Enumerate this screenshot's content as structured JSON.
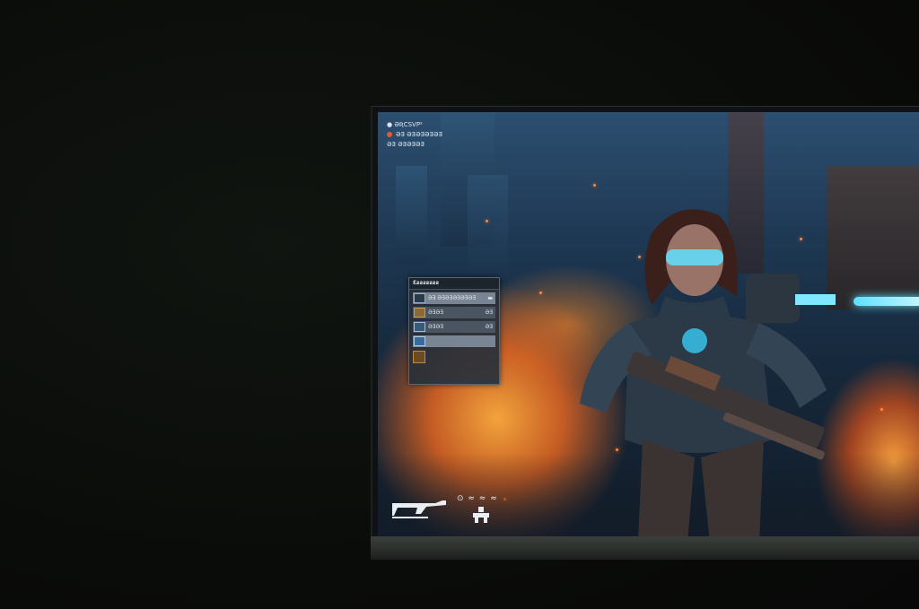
{
  "hud": {
    "top_lines": [
      {
        "text": "● ƏƦCSVP²",
        "color": "#d8e6f2"
      },
      {
        "text": "ƏƎ ƏƎƏƎƏƎƏƎ",
        "color": "#e05a3a"
      },
      {
        "text": "ƏƎ ƏƎƏƎƏƎ",
        "color": "#d8e6f2"
      }
    ],
    "ammo_text": "⊙ ≈ ≈ ≈",
    "weapon_icon": "rifle-icon",
    "controls_icon": "gamepad-icon"
  },
  "inventory": {
    "title": "Ɛƨƨƨƨƨƨƨ",
    "rows": [
      {
        "label": "ƏƎ ƏƎƏƎƏƎƏƎƏƎ",
        "value": "▬",
        "selected": true
      },
      {
        "label": "ƏƎƏƎ",
        "value": "ƏƎ",
        "selected": false
      },
      {
        "label": "ƏƎƏƎ",
        "value": "ƏƎ",
        "selected": false
      },
      {
        "label": "",
        "value": "",
        "selected": true
      }
    ]
  },
  "colors": {
    "fire": "#ff8a3a",
    "visor": "#5fe0ff",
    "hud_text": "#d8e6f2",
    "panel": "#28303a"
  }
}
